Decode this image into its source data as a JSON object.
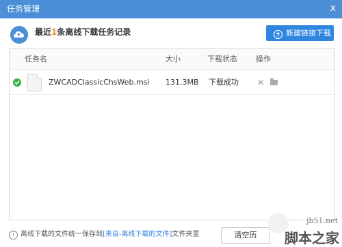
{
  "window": {
    "title": "任务管理",
    "close_glyph": "x"
  },
  "header": {
    "headline_prefix": "最近",
    "headline_count": "1",
    "headline_suffix": "条离线下载任务记录",
    "new_button_label": "新建链接下载"
  },
  "table": {
    "columns": {
      "name": "任务名",
      "size": "大小",
      "status": "下载状态",
      "actions": "操作"
    },
    "rows": [
      {
        "name": "ZWCADClassicChsWeb.msi",
        "size": "131.3MB",
        "status": "下载成功"
      }
    ]
  },
  "footer": {
    "info_glyph": "i",
    "note_prefix": "离线下载的文件统一保存到",
    "note_link": "[来自-离线下载的文件]",
    "note_suffix": "文件夹里",
    "clear_button_label": "清空历"
  },
  "watermark": {
    "site": "jb51.net",
    "name": "脚本之家"
  },
  "colors": {
    "titlebar": "#4a8fd8",
    "primary_button": "#2f86e0",
    "success": "#3bb34a",
    "highlight": "#f28a1e"
  },
  "icons": {
    "header": "cloud-icon",
    "new_button": "cloud-upload-icon",
    "row_status": "check-circle-icon",
    "row_file": "file-icon",
    "row_delete": "close-icon",
    "row_open": "folder-icon",
    "footer": "info-icon"
  }
}
